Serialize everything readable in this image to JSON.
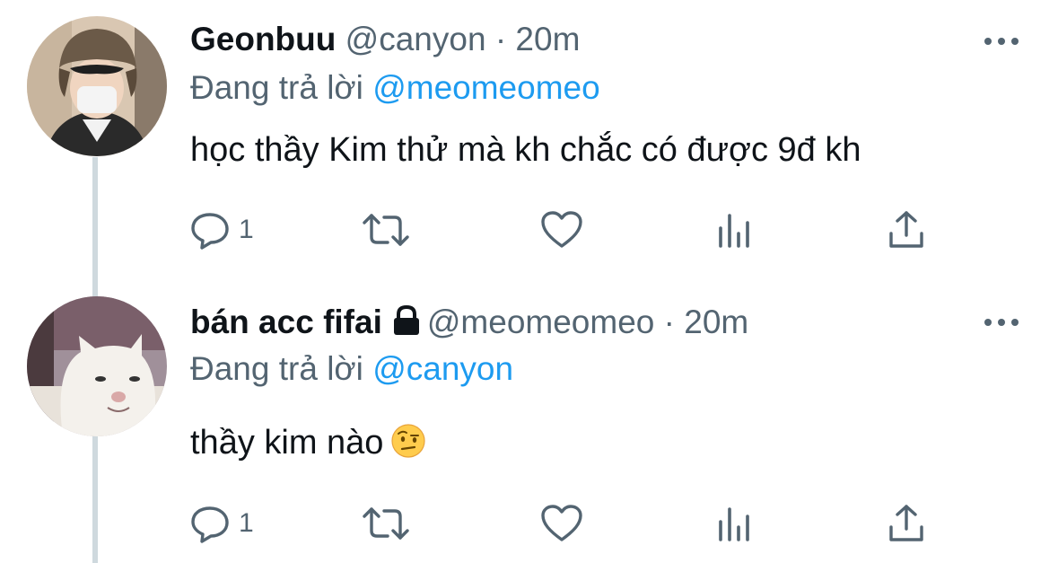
{
  "tweets": [
    {
      "display_name": "Geonbuu",
      "handle": "@canyon",
      "separator": "·",
      "time": "20m",
      "locked": false,
      "replying_prefix": "Đang trả lời",
      "replying_to": "@meomeomeo",
      "text": "học thầy Kim thử mà kh chắc có được 9đ kh",
      "reply_count": "1",
      "avatar": "person-with-fur-hat-and-mask"
    },
    {
      "display_name": "bán acc fifai",
      "handle": "@meomeomeo",
      "separator": "·",
      "time": "20m",
      "locked": true,
      "replying_prefix": "Đang trả lời",
      "replying_to": "@canyon",
      "text": "thầy kim nào",
      "emoji": "face-with-raised-eyebrow",
      "reply_count": "1",
      "avatar": "white-cat"
    }
  ],
  "icons": {
    "more": "more-horizontal-icon",
    "reply": "reply-icon",
    "retweet": "retweet-icon",
    "like": "like-heart-icon",
    "views": "analytics-icon",
    "share": "share-icon"
  },
  "colors": {
    "text": "#0f1419",
    "secondary": "#536471",
    "link": "#1d9bf0",
    "thread_line": "#cfd9de"
  }
}
